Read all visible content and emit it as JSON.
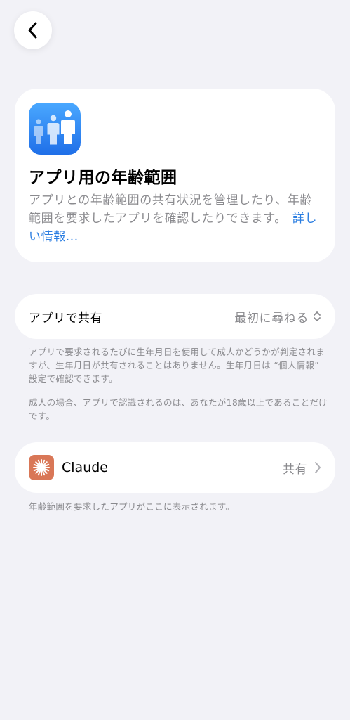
{
  "colors": {
    "background": "#f2f2f7",
    "card": "#ffffff",
    "secondary_text": "#8a8a8e",
    "link": "#2a7de1",
    "app_icon_blue": "#1f6fe8",
    "claude_brand": "#d97757"
  },
  "nav": {
    "back_icon": "chevron-left-icon"
  },
  "intro": {
    "icon": "people-icon",
    "title": "アプリ用の年齢範囲",
    "description": "アプリとの年齢範囲の共有状況を管理したり、年齢範囲を要求したアプリを確認したりできます。",
    "link": "詳しい情報..."
  },
  "share_setting": {
    "label": "アプリで共有",
    "value": "最初に尋ねる",
    "icon": "up-down-chevron-icon"
  },
  "footnotes": {
    "share_info_1": "アプリで要求されるたびに生年月日を使用して成人かどうかが判定されますが、生年月日が共有されることはありません。生年月日は “個人情報” 設定で確認できます。",
    "share_info_2": "成人の場合、アプリで認識されるのは、あなたが18歳以上であることだけです。",
    "apps_info": "年齢範囲を要求したアプリがここに表示されます。"
  },
  "apps": [
    {
      "name": "Claude",
      "status": "共有",
      "icon": "claude-logo-icon"
    }
  ]
}
